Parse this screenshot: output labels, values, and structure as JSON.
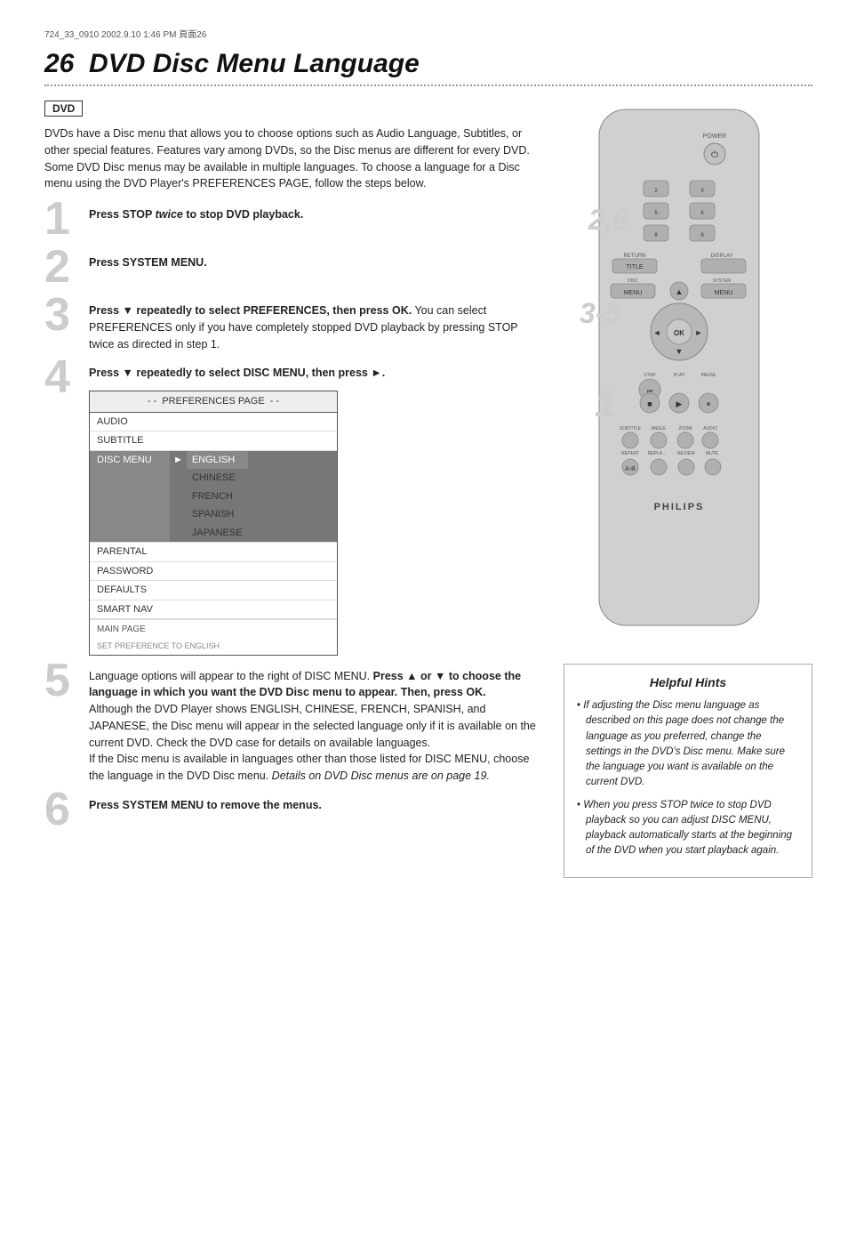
{
  "meta": {
    "file_info": "724_33_0910  2002.9.10  1:46 PM  頁面26"
  },
  "page": {
    "chapter_number": "26",
    "title": "DVD Disc Menu Language",
    "dvd_badge": "DVD",
    "intro": [
      "DVDs have a Disc menu that allows you to choose options such as Audio Language, Subtitles, or other special features. Features vary among DVDs, so the Disc menus are different for every DVD.",
      "Some DVD Disc menus may be available in multiple languages. To choose a language for a Disc menu using the DVD Player's PREFERENCES PAGE, follow the steps below."
    ]
  },
  "steps": [
    {
      "number": "1",
      "text_bold": "Press STOP twice to stop DVD playback.",
      "text_normal": ""
    },
    {
      "number": "2",
      "text_bold": "Press SYSTEM MENU.",
      "text_normal": ""
    },
    {
      "number": "3",
      "text_bold": "Press ▼ repeatedly to select PREFERENCES, then press OK.",
      "text_normal": " You can select PREFERENCES only if you have completely stopped DVD playback by pressing STOP twice as directed in step 1."
    },
    {
      "number": "4",
      "text_bold": "Press ▼ repeatedly to select DISC MENU, then press ►.",
      "text_normal": ""
    },
    {
      "number": "5",
      "text_intro": "Language options will appear to the right of DISC MENU. ",
      "text_bold": "Press ▲ or ▼ to choose the language in which you want the DVD Disc menu to appear. Then, press OK.",
      "text_normal": " Although the DVD Player shows ENGLISH, CHINESE, FRENCH, SPANISH, and JAPANESE, the Disc menu will appear in the selected language only if it is available on the current DVD. Check the DVD case for details on available languages.\nIf the Disc menu is available in languages other than those listed for DISC MENU, choose the language in the DVD Disc menu. Details on DVD Disc menus are on page 19."
    },
    {
      "number": "6",
      "text_bold": "Press SYSTEM MENU to remove the menus.",
      "text_normal": ""
    }
  ],
  "preferences_page": {
    "title": "- -  PREFERENCES PAGE  - -",
    "rows": [
      {
        "label": "AUDIO",
        "value": "",
        "highlighted": false,
        "arrow": false
      },
      {
        "label": "SUBTITLE",
        "value": "",
        "highlighted": false,
        "arrow": false
      },
      {
        "label": "DISC MENU",
        "value": "",
        "highlighted": true,
        "arrow": true,
        "languages": [
          "ENGLISH",
          "CHINESE",
          "FRENCH",
          "SPANISH",
          "JAPANESE"
        ],
        "active_lang": "ENGLISH"
      },
      {
        "label": "PARENTAL",
        "value": "",
        "highlighted": false,
        "arrow": false
      },
      {
        "label": "PASSWORD",
        "value": "",
        "highlighted": false,
        "arrow": false
      },
      {
        "label": "DEFAULTS",
        "value": "",
        "highlighted": false,
        "arrow": false
      },
      {
        "label": "SMART NAV",
        "value": "",
        "highlighted": false,
        "arrow": false
      }
    ],
    "bottom": "MAIN PAGE",
    "bottom2": "SET PREFERENCE TO ENGLISH"
  },
  "helpful_hints": {
    "title": "Helpful Hints",
    "hints": [
      "If adjusting the Disc menu language as described on this page does not change the language as you preferred, change the settings in the DVD's Disc menu. Make sure the language you want is available on the current DVD.",
      "When you press STOP twice to stop DVD playback so you can adjust DISC MENU, playback automatically starts at the beginning of the DVD when you start playback again."
    ]
  },
  "remote": {
    "step_labels": [
      "2,6",
      "3-5",
      "1"
    ],
    "brand": "PHILIPS"
  }
}
